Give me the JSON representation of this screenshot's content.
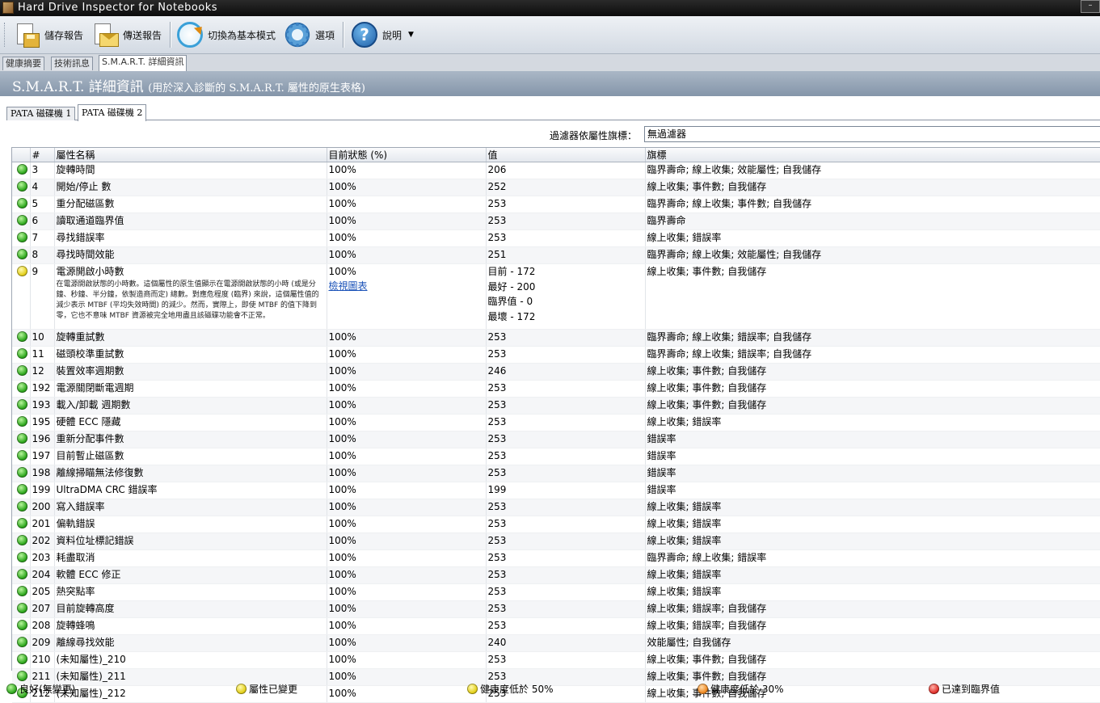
{
  "window": {
    "title": "Hard Drive Inspector for Notebooks"
  },
  "toolbar": {
    "save_label": "儲存報告",
    "send_label": "傳送報告",
    "switch_label": "切換為基本模式",
    "options_label": "選項",
    "help_label": "說明"
  },
  "tabs": {
    "summary": "健康摘要",
    "tech": "技術訊息",
    "smart": "S.M.A.R.T. 詳細資訊"
  },
  "header": {
    "title": "S.M.A.R.T. 詳細資訊",
    "subtitle": "(用於深入診斷的 S.M.A.R.T. 屬性的原生表格)"
  },
  "disk_tabs": {
    "disk1": "PATA 磁碟機 1",
    "disk2": "PATA 磁碟機 2"
  },
  "filter": {
    "label": "過濾器依屬性旗標：",
    "value": "無過濾器"
  },
  "columns": {
    "num": "#",
    "name": "屬性名稱",
    "state": "目前狀態 (%)",
    "value": "值",
    "flags": "旗標"
  },
  "rows": [
    {
      "status": "green",
      "id": "3",
      "name": "旋轉時間",
      "state": "100%",
      "value": "206",
      "flags": "臨界壽命; 線上收集; 效能屬性; 自我儲存"
    },
    {
      "status": "green",
      "id": "4",
      "name": "開始/停止 數",
      "state": "100%",
      "value": "252",
      "flags": "線上收集; 事件數; 自我儲存"
    },
    {
      "status": "green",
      "id": "5",
      "name": "重分配磁區數",
      "state": "100%",
      "value": "253",
      "flags": "臨界壽命; 線上收集; 事件數; 自我儲存"
    },
    {
      "status": "green",
      "id": "6",
      "name": "讀取通道臨界值",
      "state": "100%",
      "value": "253",
      "flags": "臨界壽命"
    },
    {
      "status": "green",
      "id": "7",
      "name": "尋找錯誤率",
      "state": "100%",
      "value": "253",
      "flags": "線上收集; 錯誤率"
    },
    {
      "status": "green",
      "id": "8",
      "name": "尋找時間效能",
      "state": "100%",
      "value": "251",
      "flags": "臨界壽命; 線上收集; 效能屬性; 自我儲存"
    }
  ],
  "expanded_row": {
    "status": "yellow",
    "id": "9",
    "name": "電源開啟小時數",
    "state": "100%",
    "description": "在電源開啟狀態的小時數。這個屬性的原生值顯示在電源開啟狀態的小時 (或是分鐘、秒鐘、半分鐘，依製造商而定) 總數。對應危程度 (臨界) 來說，這個屬性值的減少表示 MTBF (平均失效時間) 的減少。然而，實際上，即使 MTBF 的值下降到零，它也不意味 MTBF 資源被完全地用盡且該磁碟功能會不正常。",
    "view_chart": "檢視圖表",
    "value_current": "目前 - 172",
    "value_best": "最好 - 200",
    "value_threshold": "臨界值 - 0",
    "value_worst": "最壞 - 172",
    "flags": "線上收集; 事件數; 自我儲存"
  },
  "rows_after": [
    {
      "status": "green",
      "id": "10",
      "name": "旋轉重試數",
      "state": "100%",
      "value": "253",
      "flags": "臨界壽命; 線上收集; 錯誤率; 自我儲存"
    },
    {
      "status": "green",
      "id": "11",
      "name": "磁頭校準重試數",
      "state": "100%",
      "value": "253",
      "flags": "臨界壽命; 線上收集; 錯誤率; 自我儲存"
    },
    {
      "status": "green",
      "id": "12",
      "name": "裝置效率週期數",
      "state": "100%",
      "value": "246",
      "flags": "線上收集; 事件數; 自我儲存"
    },
    {
      "status": "green",
      "id": "192",
      "name": "電源關閉斷電週期",
      "state": "100%",
      "value": "253",
      "flags": "線上收集; 事件數; 自我儲存"
    },
    {
      "status": "green",
      "id": "193",
      "name": "載入/卸載 週期數",
      "state": "100%",
      "value": "253",
      "flags": "線上收集; 事件數; 自我儲存"
    },
    {
      "status": "green",
      "id": "195",
      "name": "硬體 ECC 隱藏",
      "state": "100%",
      "value": "253",
      "flags": "線上收集; 錯誤率"
    },
    {
      "status": "green",
      "id": "196",
      "name": "重新分配事件數",
      "state": "100%",
      "value": "253",
      "flags": "錯誤率"
    },
    {
      "status": "green",
      "id": "197",
      "name": "目前暫止磁區數",
      "state": "100%",
      "value": "253",
      "flags": "錯誤率"
    },
    {
      "status": "green",
      "id": "198",
      "name": "離線掃瞄無法修復數",
      "state": "100%",
      "value": "253",
      "flags": "錯誤率"
    },
    {
      "status": "green",
      "id": "199",
      "name": "UltraDMA CRC 錯誤率",
      "state": "100%",
      "value": "199",
      "flags": "錯誤率"
    },
    {
      "status": "green",
      "id": "200",
      "name": "寫入錯誤率",
      "state": "100%",
      "value": "253",
      "flags": "線上收集; 錯誤率"
    },
    {
      "status": "green",
      "id": "201",
      "name": "偏軌錯誤",
      "state": "100%",
      "value": "253",
      "flags": "線上收集; 錯誤率"
    },
    {
      "status": "green",
      "id": "202",
      "name": "資料位址標記錯誤",
      "state": "100%",
      "value": "253",
      "flags": "線上收集; 錯誤率"
    },
    {
      "status": "green",
      "id": "203",
      "name": "耗盡取消",
      "state": "100%",
      "value": "253",
      "flags": "臨界壽命; 線上收集; 錯誤率"
    },
    {
      "status": "green",
      "id": "204",
      "name": "軟體 ECC 修正",
      "state": "100%",
      "value": "253",
      "flags": "線上收集; 錯誤率"
    },
    {
      "status": "green",
      "id": "205",
      "name": "熱突點率",
      "state": "100%",
      "value": "253",
      "flags": "線上收集; 錯誤率"
    },
    {
      "status": "green",
      "id": "207",
      "name": "目前旋轉高度",
      "state": "100%",
      "value": "253",
      "flags": "線上收集; 錯誤率; 自我儲存"
    },
    {
      "status": "green",
      "id": "208",
      "name": "旋轉蜂鳴",
      "state": "100%",
      "value": "253",
      "flags": "線上收集; 錯誤率; 自我儲存"
    },
    {
      "status": "green",
      "id": "209",
      "name": "離線尋找效能",
      "state": "100%",
      "value": "240",
      "flags": "效能屬性; 自我儲存"
    },
    {
      "status": "green",
      "id": "210",
      "name": "(未知屬性)_210",
      "state": "100%",
      "value": "253",
      "flags": "線上收集; 事件數; 自我儲存"
    },
    {
      "status": "green",
      "id": "211",
      "name": "(未知屬性)_211",
      "state": "100%",
      "value": "253",
      "flags": "線上收集; 事件數; 自我儲存"
    },
    {
      "status": "green",
      "id": "212",
      "name": "(未知屬性)_212",
      "state": "100%",
      "value": "253",
      "flags": "線上收集; 事件數; 自我儲存"
    }
  ],
  "legend": {
    "good": "良好(無變更)",
    "changed": "屬性已變更",
    "below50": "健康度低於 50%",
    "below30": "健康度低於 30%",
    "threshold": "已達到臨界值"
  },
  "colors": {
    "good": "#2fa81e",
    "changed": "#e3cf1a",
    "below50": "#e3cf1a",
    "below30": "#f08a22",
    "threshold": "#e0302a",
    "banner": "#8f9fb2"
  }
}
